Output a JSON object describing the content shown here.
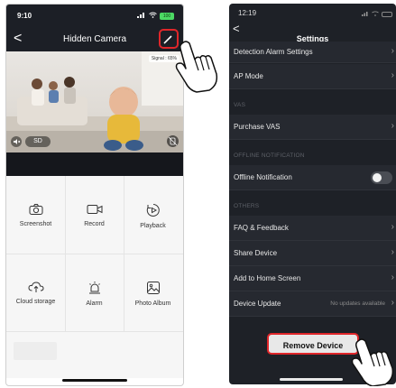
{
  "left_screen": {
    "status": {
      "time": "9:10",
      "battery": "100"
    },
    "nav": {
      "back": "<",
      "title": "Hidden Camera"
    },
    "video": {
      "signal_label": "Signal : 65%",
      "mute_icon": "speaker-muted-icon",
      "quality_label": "SD",
      "rotate_icon": "rotate-icon"
    },
    "features": [
      {
        "label": "Screenshot",
        "icon": "camera-icon"
      },
      {
        "label": "Record",
        "icon": "video-record-icon"
      },
      {
        "label": "Playback",
        "icon": "playback-icon"
      },
      {
        "label": "Cloud storage",
        "icon": "cloud-icon"
      },
      {
        "label": "Alarm",
        "icon": "alarm-light-icon"
      },
      {
        "label": "Photo Album",
        "icon": "photo-icon"
      }
    ]
  },
  "right_screen": {
    "status": {
      "time": "12:19"
    },
    "nav": {
      "back": "<",
      "title": "Settings"
    },
    "rows": {
      "detection_alarm": "Detection Alarm Settings",
      "ap_mode": "AP Mode",
      "purchase_vas": "Purchase VAS",
      "offline_notification": "Offline Notification",
      "faq": "FAQ & Feedback",
      "share_device": "Share Device",
      "add_home": "Add to Home Screen",
      "device_update": "Device Update",
      "device_update_value": "No updates available"
    },
    "sections": {
      "vas": "VAS",
      "offline": "OFFLINE NOTIFICATION",
      "others": "OTHERS"
    },
    "offline_notification_on": false,
    "remove_label": "Remove Device"
  },
  "colors": {
    "highlight": "#e0262a",
    "dark_bg": "#1e2127",
    "row_bg": "#262930"
  }
}
